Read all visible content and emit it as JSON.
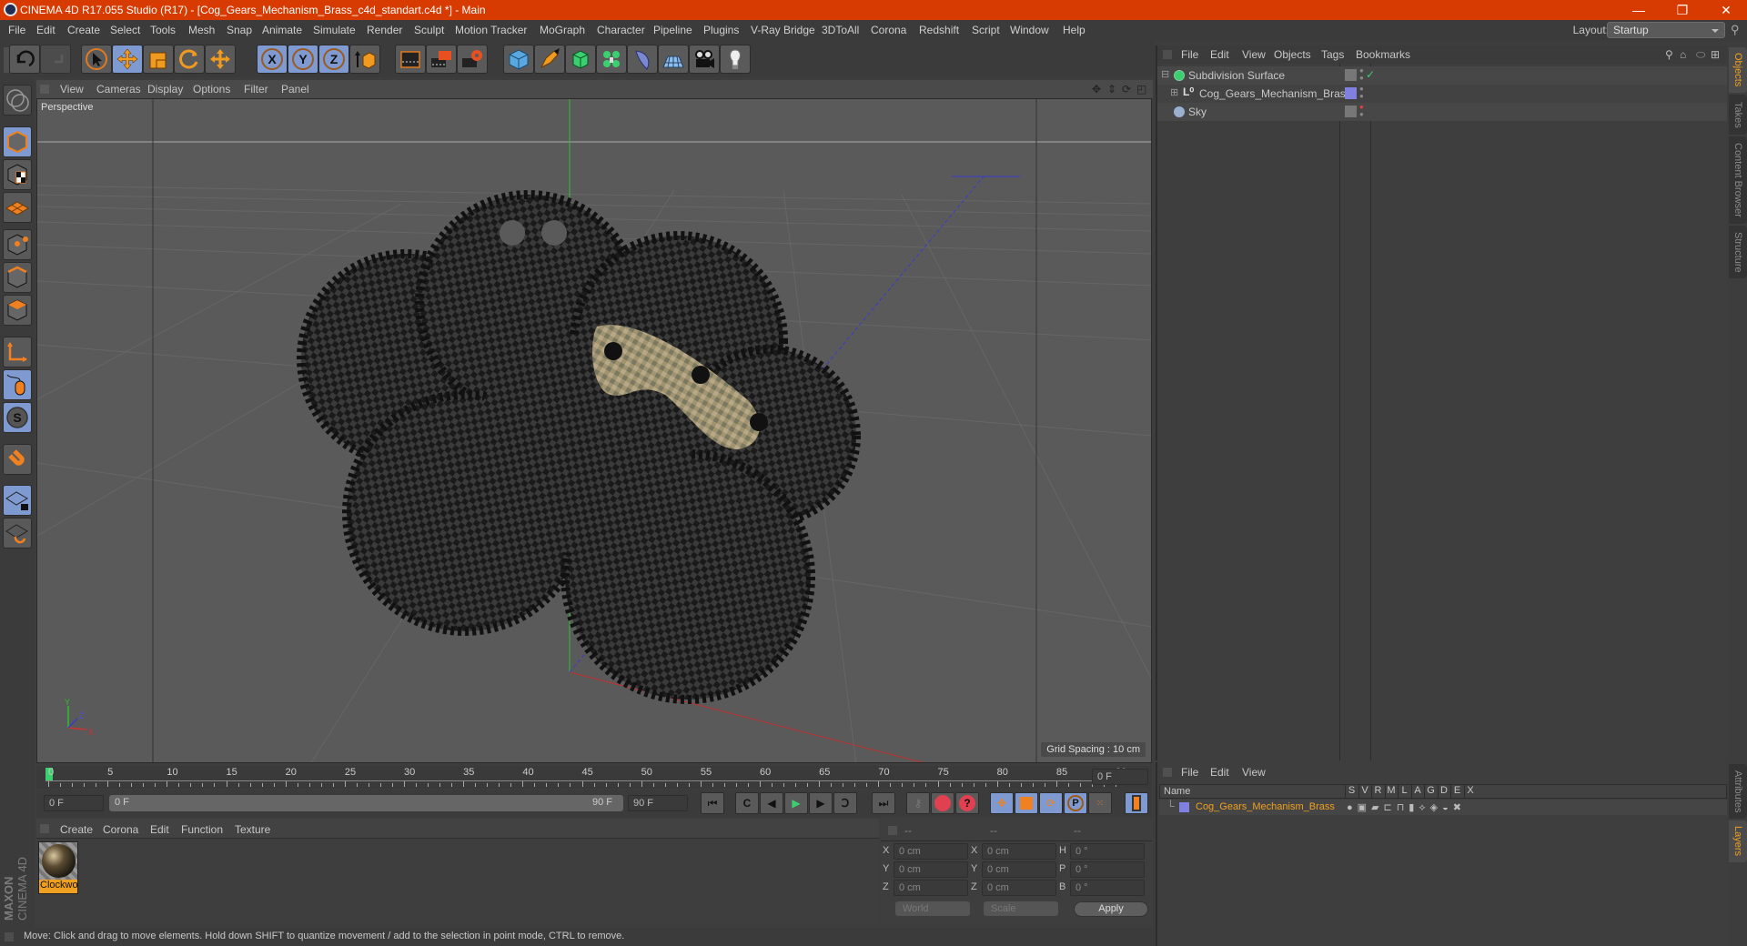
{
  "window": {
    "title": "CINEMA 4D R17.055 Studio (R17) - [Cog_Gears_Mechanism_Brass_c4d_standart.c4d *] - Main",
    "controls": {
      "minimize": "—",
      "restore": "❐",
      "close": "✕"
    }
  },
  "menubar": {
    "items": [
      "File",
      "Edit",
      "Create",
      "Select",
      "Tools",
      "Mesh",
      "Snap",
      "Animate",
      "Simulate",
      "Render",
      "Sculpt",
      "Motion Tracker",
      "MoGraph",
      "Character",
      "Pipeline",
      "Plugins",
      "V-Ray Bridge",
      "3DToAll",
      "Corona",
      "Redshift",
      "Script",
      "Window",
      "Help"
    ],
    "layout_label": "Layout:",
    "layout_value": "Startup"
  },
  "toolbar": {
    "icons": [
      "undo-icon",
      "redo-icon",
      "select-icon",
      "move-icon",
      "scale-icon",
      "rotate-icon",
      "live-move-icon",
      "x-axis-icon",
      "y-axis-icon",
      "z-axis-icon",
      "coordinate-system-icon",
      "render-view-icon",
      "render-picture-viewer-icon",
      "render-settings-icon",
      "cube-icon",
      "pen-icon",
      "subdivision-icon",
      "cloner-icon",
      "deformer-icon",
      "floor-icon",
      "camera-icon",
      "light-icon"
    ],
    "axis_labels": [
      "X",
      "Y",
      "Z"
    ]
  },
  "left_tools": [
    "make-editable-icon",
    "model-mode-icon",
    "texture-mode-icon",
    "workplane-mode-icon",
    "points-mode-icon",
    "edges-mode-icon",
    "polygons-mode-icon",
    "axis-mode-icon",
    "tweak-mode-icon",
    "solo-icon",
    "snap-icon",
    "workplane-lock-icon",
    "workplane-rotate-icon"
  ],
  "viewport": {
    "menu": [
      "View",
      "Cameras",
      "Display",
      "Options",
      "Filter",
      "Panel"
    ],
    "label": "Perspective",
    "grid_spacing": "Grid Spacing : 10 cm",
    "axis": {
      "x": "X",
      "y": "Y",
      "z": "Z"
    }
  },
  "timeline": {
    "ticks": [
      "0",
      "5",
      "10",
      "15",
      "20",
      "25",
      "30",
      "35",
      "40",
      "45",
      "50",
      "55",
      "60",
      "65",
      "70",
      "75",
      "80",
      "85",
      "90"
    ],
    "current_frame": "0 F",
    "start_field": "0 F",
    "range_start": "0 F",
    "range_end": "90 F",
    "end_field": "90 F",
    "frame_field_right": "0 F"
  },
  "material_panel": {
    "menu": [
      "Create",
      "Corona",
      "Edit",
      "Function",
      "Texture"
    ],
    "materials": [
      {
        "name": "Clockwo"
      }
    ]
  },
  "coord_panel": {
    "headers": [
      "--",
      "--",
      "--"
    ],
    "rows": [
      {
        "l1": "X",
        "v1": "0 cm",
        "l2": "X",
        "v2": "0 cm",
        "l3": "H",
        "v3": "0 °"
      },
      {
        "l1": "Y",
        "v1": "0 cm",
        "l2": "Y",
        "v2": "0 cm",
        "l3": "P",
        "v3": "0 °"
      },
      {
        "l1": "Z",
        "v1": "0 cm",
        "l2": "Z",
        "v2": "0 cm",
        "l3": "B",
        "v3": "0 °"
      }
    ],
    "space": "World",
    "mode": "Scale",
    "apply": "Apply"
  },
  "status": "Move: Click and drag to move elements. Hold down SHIFT to quantize movement / add to the selection in point mode, CTRL to remove.",
  "branding": {
    "maxon": "MAXON",
    "product": "CINEMA 4D"
  },
  "object_manager": {
    "menu": [
      "File",
      "Edit",
      "View",
      "Objects",
      "Tags",
      "Bookmarks"
    ],
    "objects": [
      {
        "name": "Subdivision Surface",
        "indent": 0
      },
      {
        "name": "Cog_Gears_Mechanism_Brass",
        "indent": 1
      },
      {
        "name": "Sky",
        "indent": 0
      }
    ]
  },
  "right_tabs_top": [
    "Objects",
    "Takes",
    "Content Browser",
    "Structure"
  ],
  "right_tabs_bottom": [
    "Attributes",
    "Layers"
  ],
  "layer_manager": {
    "menu": [
      "File",
      "Edit",
      "View"
    ],
    "columns": [
      "Name",
      "S",
      "V",
      "R",
      "M",
      "L",
      "A",
      "G",
      "D",
      "E",
      "X"
    ],
    "layers": [
      {
        "name": "Cog_Gears_Mechanism_Brass",
        "color": "#8080e0"
      }
    ]
  },
  "colors": {
    "accent_orange": "#f0a020",
    "title_bar": "#d83b01",
    "selected_blue": "#7e9ad0"
  }
}
